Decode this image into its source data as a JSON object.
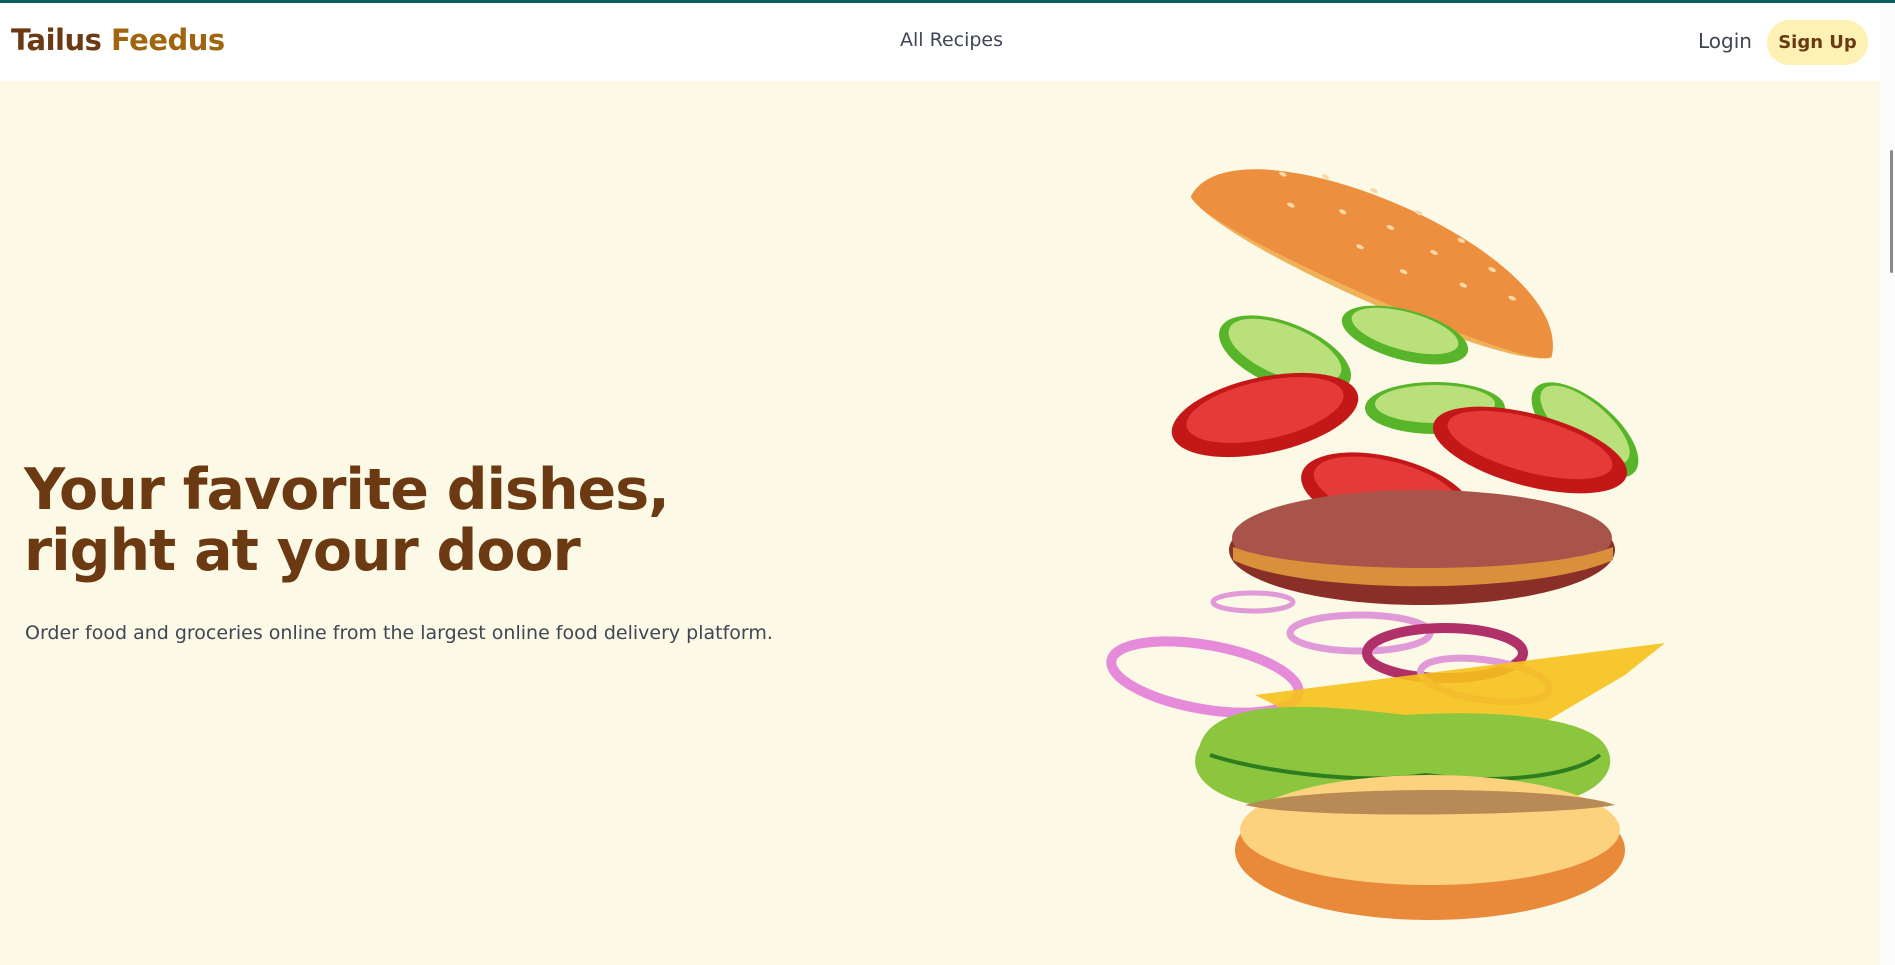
{
  "brand": {
    "part1": "Tailus",
    "part2": "Feedus"
  },
  "nav": {
    "link": "All Recipes",
    "login": "Login",
    "signup": "Sign Up"
  },
  "hero": {
    "title": "Your favorite dishes, right at your door",
    "subtitle": "Order food and groceries online from the largest online food delivery platform."
  },
  "colors": {
    "background": "#fdf9e7",
    "brand_dark": "#6b3a12",
    "brand_accent": "#a0650f",
    "signup_bg": "#fdf1b3",
    "top_accent": "#0e5f5b"
  },
  "illustration": "floating-burger"
}
